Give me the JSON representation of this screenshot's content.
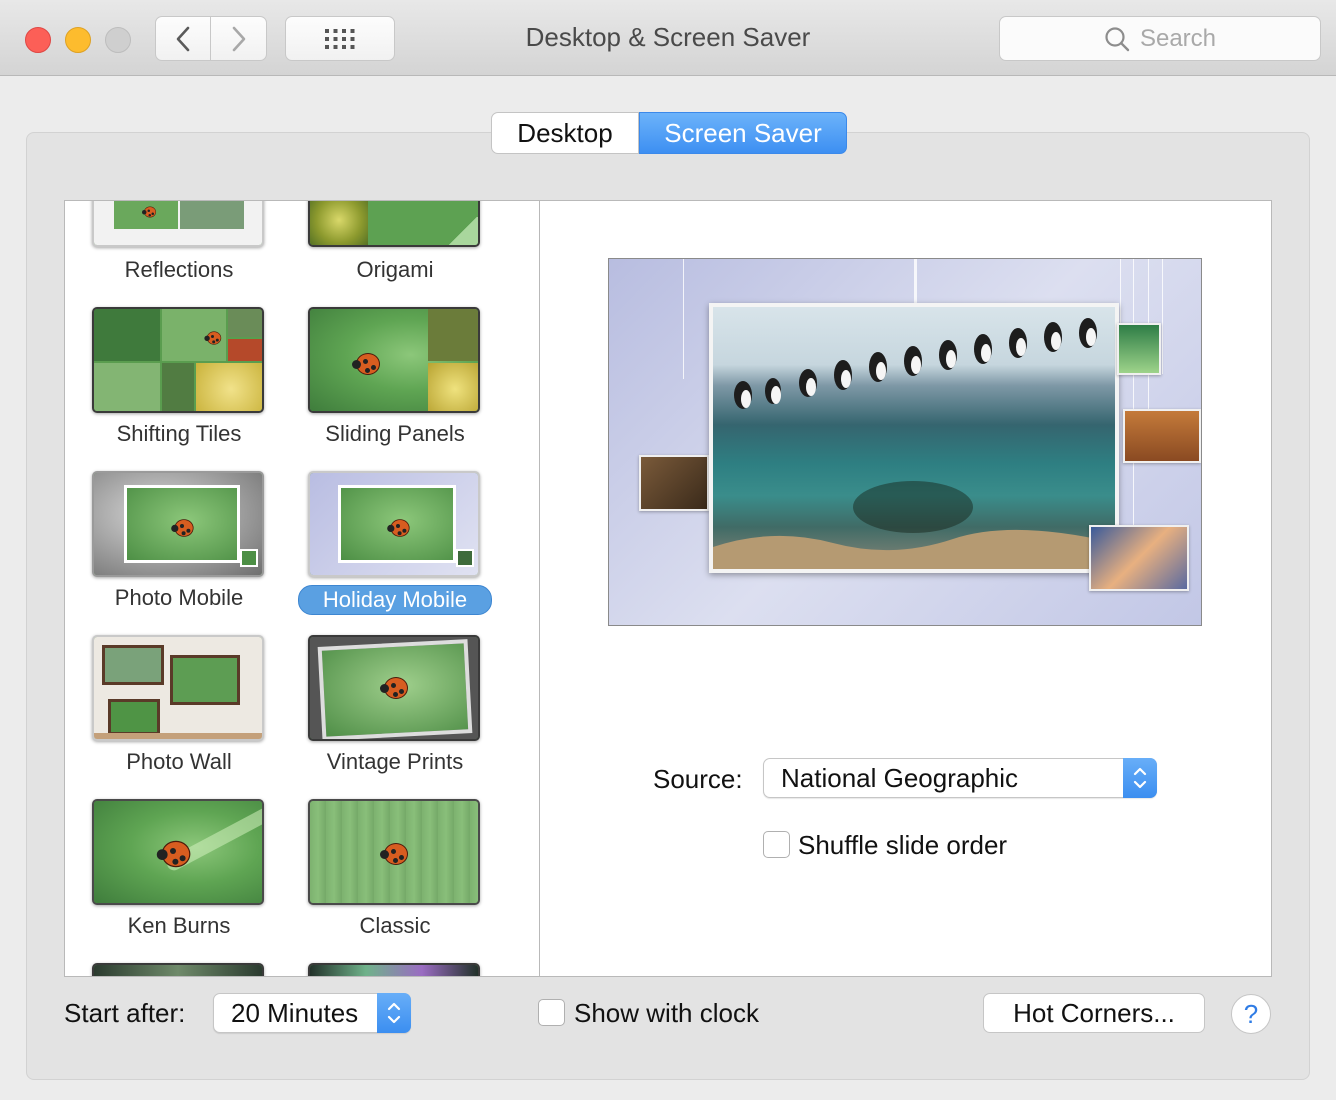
{
  "window": {
    "title": "Desktop & Screen Saver"
  },
  "search": {
    "placeholder": "Search"
  },
  "tabs": [
    {
      "label": "Desktop",
      "selected": false
    },
    {
      "label": "Screen Saver",
      "selected": true
    }
  ],
  "screensavers": [
    {
      "label": "Reflections"
    },
    {
      "label": "Origami"
    },
    {
      "label": "Shifting Tiles"
    },
    {
      "label": "Sliding Panels"
    },
    {
      "label": "Photo Mobile"
    },
    {
      "label": "Holiday Mobile",
      "selected": true
    },
    {
      "label": "Photo Wall"
    },
    {
      "label": "Vintage Prints"
    },
    {
      "label": "Ken Burns"
    },
    {
      "label": "Classic"
    }
  ],
  "options": {
    "source_label": "Source:",
    "source_value": "National Geographic",
    "shuffle_label": "Shuffle slide order",
    "shuffle_checked": false
  },
  "footer": {
    "start_after_label": "Start after:",
    "start_after_value": "20 Minutes",
    "show_clock_label": "Show with clock",
    "show_clock_checked": false,
    "hot_corners_label": "Hot Corners...",
    "help_label": "?"
  },
  "colors": {
    "accent": "#3d8ff2",
    "selection": "#5aa0e2",
    "close": "#fc5f57",
    "minimize": "#fdbc2e"
  }
}
